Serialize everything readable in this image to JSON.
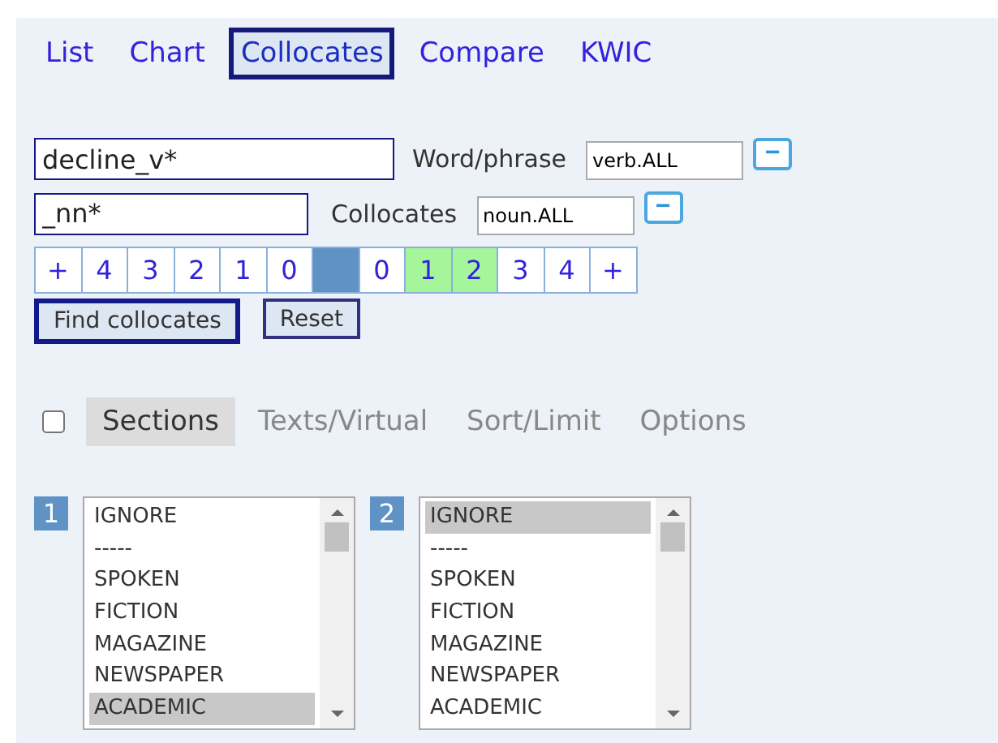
{
  "tabs": [
    {
      "label": "List",
      "selected": false
    },
    {
      "label": "Chart",
      "selected": false
    },
    {
      "label": "Collocates",
      "selected": true
    },
    {
      "label": "Compare",
      "selected": false
    },
    {
      "label": "KWIC",
      "selected": false
    }
  ],
  "word_row": {
    "value": "decline_v*",
    "label": "Word/phrase",
    "pos_value": "verb.ALL",
    "button": "−"
  },
  "collocates_row": {
    "value": "_nn*",
    "label": "Collocates",
    "pos_value": "noun.ALL",
    "button": "−"
  },
  "span": [
    {
      "kind": "text",
      "label": "+",
      "selected": false
    },
    {
      "kind": "text",
      "label": "4",
      "selected": false
    },
    {
      "kind": "text",
      "label": "3",
      "selected": false
    },
    {
      "kind": "text",
      "label": "2",
      "selected": false
    },
    {
      "kind": "text",
      "label": "1",
      "selected": false
    },
    {
      "kind": "text",
      "label": "0",
      "selected": false
    },
    {
      "kind": "node",
      "selected": false
    },
    {
      "kind": "text",
      "label": "0",
      "selected": false
    },
    {
      "kind": "text",
      "label": "1",
      "selected": true
    },
    {
      "kind": "text",
      "label": "2",
      "selected": true
    },
    {
      "kind": "text",
      "label": "3",
      "selected": false
    },
    {
      "kind": "text",
      "label": "4",
      "selected": false
    },
    {
      "kind": "text",
      "label": "+",
      "selected": false
    }
  ],
  "buttons": [
    "Find collocates",
    "Reset"
  ],
  "options": {
    "checked": false,
    "tabs": [
      {
        "label": "Sections",
        "selected": true
      },
      {
        "label": "Texts/Virtual",
        "selected": false
      },
      {
        "label": "Sort/Limit",
        "selected": false
      },
      {
        "label": "Options",
        "selected": false
      }
    ]
  },
  "section_lists": [
    {
      "number": "1",
      "items": [
        {
          "label": "IGNORE",
          "selected": false
        },
        {
          "label": "-----",
          "selected": false
        },
        {
          "label": "SPOKEN",
          "selected": false
        },
        {
          "label": "FICTION",
          "selected": false
        },
        {
          "label": "MAGAZINE",
          "selected": false
        },
        {
          "label": "NEWSPAPER",
          "selected": false
        },
        {
          "label": "ACADEMIC",
          "selected": true
        }
      ]
    },
    {
      "number": "2",
      "items": [
        {
          "label": "IGNORE",
          "selected": true
        },
        {
          "label": "-----",
          "selected": false
        },
        {
          "label": "SPOKEN",
          "selected": false
        },
        {
          "label": "FICTION",
          "selected": false
        },
        {
          "label": "MAGAZINE",
          "selected": false
        },
        {
          "label": "NEWSPAPER",
          "selected": false
        },
        {
          "label": "ACADEMIC",
          "selected": false
        }
      ]
    }
  ]
}
